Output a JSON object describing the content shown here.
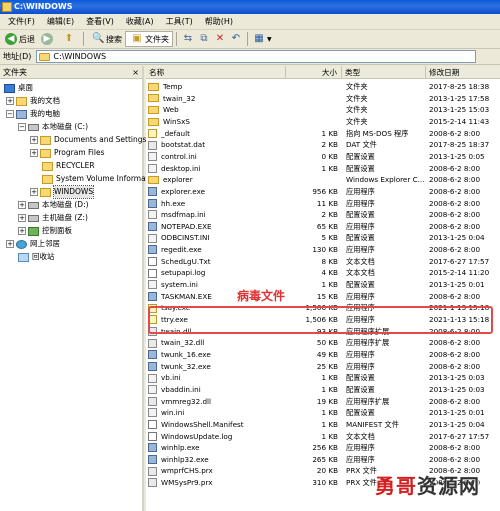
{
  "window": {
    "title": "C:\\WINDOWS"
  },
  "menu": [
    "文件(F)",
    "编辑(E)",
    "查看(V)",
    "收藏(A)",
    "工具(T)",
    "帮助(H)"
  ],
  "toolbar": {
    "back_label": "后退",
    "search_label": "搜索",
    "folders_label": "文件夹"
  },
  "address": {
    "label": "地址(D)",
    "value": "C:\\WINDOWS"
  },
  "tree": {
    "header": "文件夹",
    "close": "×",
    "items": [
      {
        "label": "桌面"
      },
      {
        "label": "我的文档"
      },
      {
        "label": "我的电脑"
      },
      {
        "label": "本地磁盘 (C:)"
      },
      {
        "label": "Documents and Settings"
      },
      {
        "label": "Program Files"
      },
      {
        "label": "RECYCLER"
      },
      {
        "label": "System Volume Information"
      },
      {
        "label": "WINDOWS"
      },
      {
        "label": "本地磁盘 (D:)"
      },
      {
        "label": "主机磁盘 (Z:)"
      },
      {
        "label": "控制面板"
      },
      {
        "label": "网上邻居"
      },
      {
        "label": "回收站"
      }
    ]
  },
  "list": {
    "columns": [
      "名称",
      "大小",
      "类型",
      "修改日期"
    ],
    "rows": [
      {
        "name": "Temp",
        "size": "",
        "type": "文件夹",
        "date": "2017-8-25 18:38",
        "icon": "folder"
      },
      {
        "name": "twain_32",
        "size": "",
        "type": "文件夹",
        "date": "2013-1-25 17:58",
        "icon": "folder"
      },
      {
        "name": "Web",
        "size": "",
        "type": "文件夹",
        "date": "2013-1-25 15:03",
        "icon": "folder"
      },
      {
        "name": "WinSxS",
        "size": "",
        "type": "文件夹",
        "date": "2015-2-14 11:43",
        "icon": "folder"
      },
      {
        "name": "_default",
        "size": "1 KB",
        "type": "指向 MS-DOS 程序",
        "date": "2008-6-2 8:00",
        "icon": "short"
      },
      {
        "name": "bootstat.dat",
        "size": "2 KB",
        "type": "DAT 文件",
        "date": "2017-8-25 18:37",
        "icon": "dll"
      },
      {
        "name": "control.ini",
        "size": "0 KB",
        "type": "配置设置",
        "date": "2013-1-25 0:05",
        "icon": "ini"
      },
      {
        "name": "desktop.ini",
        "size": "1 KB",
        "type": "配置设置",
        "date": "2008-6-2 8:00",
        "icon": "ini"
      },
      {
        "name": "explorer",
        "size": "",
        "type": "Windows Explorer C...",
        "date": "2008-6-2 8:00",
        "icon": "folder"
      },
      {
        "name": "explorer.exe",
        "size": "956 KB",
        "type": "应用程序",
        "date": "2008-6-2 8:00",
        "icon": "exe"
      },
      {
        "name": "hh.exe",
        "size": "11 KB",
        "type": "应用程序",
        "date": "2008-6-2 8:00",
        "icon": "exe"
      },
      {
        "name": "msdfmap.ini",
        "size": "2 KB",
        "type": "配置设置",
        "date": "2008-6-2 8:00",
        "icon": "ini"
      },
      {
        "name": "NOTEPAD.EXE",
        "size": "65 KB",
        "type": "应用程序",
        "date": "2008-6-2 8:00",
        "icon": "exe"
      },
      {
        "name": "ODBCINST.INI",
        "size": "5 KB",
        "type": "配置设置",
        "date": "2013-1-25 0:04",
        "icon": "ini"
      },
      {
        "name": "regedit.exe",
        "size": "130 KB",
        "type": "应用程序",
        "date": "2008-6-2 8:00",
        "icon": "exe"
      },
      {
        "name": "SchedLgU.Txt",
        "size": "8 KB",
        "type": "文本文档",
        "date": "2017-6-27 17:57",
        "icon": "txt"
      },
      {
        "name": "setupapi.log",
        "size": "4 KB",
        "type": "文本文档",
        "date": "2015-2-14 11:20",
        "icon": "txt"
      },
      {
        "name": "system.ini",
        "size": "1 KB",
        "type": "配置设置",
        "date": "2013-1-25 0:01",
        "icon": "ini"
      },
      {
        "name": "TASKMAN.EXE",
        "size": "15 KB",
        "type": "应用程序",
        "date": "2008-6-2 8:00",
        "icon": "exe"
      },
      {
        "name": "tsay.exe",
        "size": "1,506 KB",
        "type": "应用程序",
        "date": "2021-1-13 15:18",
        "icon": "short"
      },
      {
        "name": "ttry.exe",
        "size": "1,506 KB",
        "type": "应用程序",
        "date": "2021-1-13 15:18",
        "icon": "short"
      },
      {
        "name": "twain.dll",
        "size": "93 KB",
        "type": "应用程序扩展",
        "date": "2008-6-2 8:00",
        "icon": "dll"
      },
      {
        "name": "twain_32.dll",
        "size": "50 KB",
        "type": "应用程序扩展",
        "date": "2008-6-2 8:00",
        "icon": "dll"
      },
      {
        "name": "twunk_16.exe",
        "size": "49 KB",
        "type": "应用程序",
        "date": "2008-6-2 8:00",
        "icon": "exe"
      },
      {
        "name": "twunk_32.exe",
        "size": "25 KB",
        "type": "应用程序",
        "date": "2008-6-2 8:00",
        "icon": "exe"
      },
      {
        "name": "vb.ini",
        "size": "1 KB",
        "type": "配置设置",
        "date": "2013-1-25 0:03",
        "icon": "ini"
      },
      {
        "name": "vbaddin.ini",
        "size": "1 KB",
        "type": "配置设置",
        "date": "2013-1-25 0:03",
        "icon": "ini"
      },
      {
        "name": "vmmreg32.dll",
        "size": "19 KB",
        "type": "应用程序扩展",
        "date": "2008-6-2 8:00",
        "icon": "dll"
      },
      {
        "name": "win.ini",
        "size": "1 KB",
        "type": "配置设置",
        "date": "2013-1-25 0:01",
        "icon": "ini"
      },
      {
        "name": "WindowsShell.Manifest",
        "size": "1 KB",
        "type": "MANIFEST 文件",
        "date": "2013-1-25 0:04",
        "icon": "txt"
      },
      {
        "name": "WindowsUpdate.log",
        "size": "1 KB",
        "type": "文本文档",
        "date": "2017-6-27 17:57",
        "icon": "txt"
      },
      {
        "name": "winhlp.exe",
        "size": "256 KB",
        "type": "应用程序",
        "date": "2008-6-2 8:00",
        "icon": "exe"
      },
      {
        "name": "winhlp32.exe",
        "size": "265 KB",
        "type": "应用程序",
        "date": "2008-6-2 8:00",
        "icon": "exe"
      },
      {
        "name": "wmprfCHS.prx",
        "size": "20 KB",
        "type": "PRX 文件",
        "date": "2008-6-2 8:00",
        "icon": "dll"
      },
      {
        "name": "WMSysPr9.prx",
        "size": "310 KB",
        "type": "PRX 文件",
        "date": "2008-6-2 8:00",
        "icon": "dll"
      }
    ]
  },
  "annotation": {
    "label": "病毒文件",
    "color": "#e03030"
  },
  "watermark": {
    "part1": "勇哥",
    "part2": "资源网"
  }
}
